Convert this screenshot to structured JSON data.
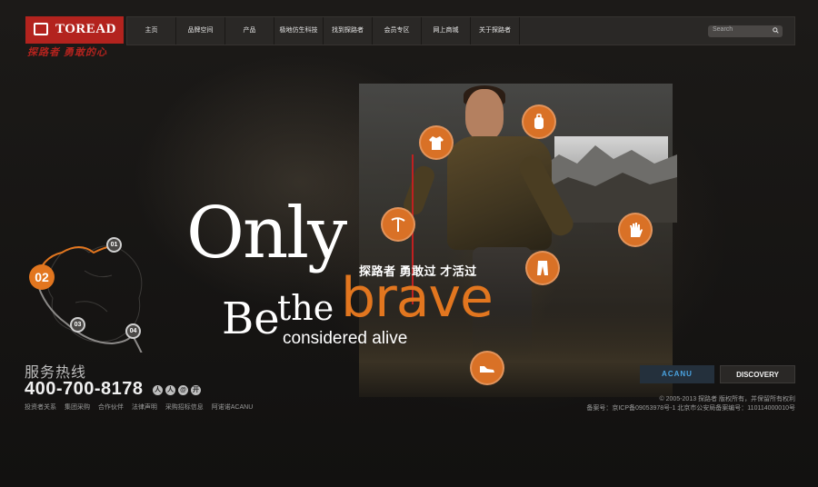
{
  "brand": {
    "name": "TOREAD",
    "slogan": "探路者 勇敢的心"
  },
  "nav": {
    "items": [
      {
        "label": "主页"
      },
      {
        "label": "品牌空间"
      },
      {
        "label": "产品"
      },
      {
        "label": "极地仿生科技"
      },
      {
        "label": "找到探路者"
      },
      {
        "label": "会员专区"
      },
      {
        "label": "网上商城"
      },
      {
        "label": "关于探路者"
      }
    ],
    "search_placeholder": "Search"
  },
  "hero": {
    "only": "Only",
    "be": "Be",
    "the": "the",
    "brave": "brave",
    "considered": "considered alive",
    "tagline": "探路者 勇敢过 才活过",
    "gear_icons": [
      "jacket-icon",
      "backpack-icon",
      "ice-axe-icon",
      "glove-icon",
      "pants-icon",
      "shoe-icon"
    ]
  },
  "map": {
    "markers": [
      "01",
      "02",
      "03",
      "04"
    ],
    "active": "02"
  },
  "hotline": {
    "title": "服务热线",
    "number": "400-700-8178"
  },
  "social_icons": [
    "renren-icon",
    "kaixin-icon",
    "weibo-icon",
    "open-icon"
  ],
  "social_glyphs": [
    "人",
    "人",
    "@",
    "开"
  ],
  "footer": {
    "links": [
      "投资者关系",
      "集团采购",
      "合作伙伴",
      "法律声明",
      "采购招标信息",
      "阿诺诺ACANU"
    ],
    "copyright": "© 2005-2013 探路者 版权所有，并保留所有权利",
    "icp": "备案号：京ICP备09053978号-1 北京市公安局备案编号：110114000010号"
  },
  "sub_brands": [
    "ACANU",
    "DISCOVERY"
  ],
  "colors": {
    "accent": "#e2761f",
    "brand_red": "#b3231e",
    "background": "#161412"
  }
}
